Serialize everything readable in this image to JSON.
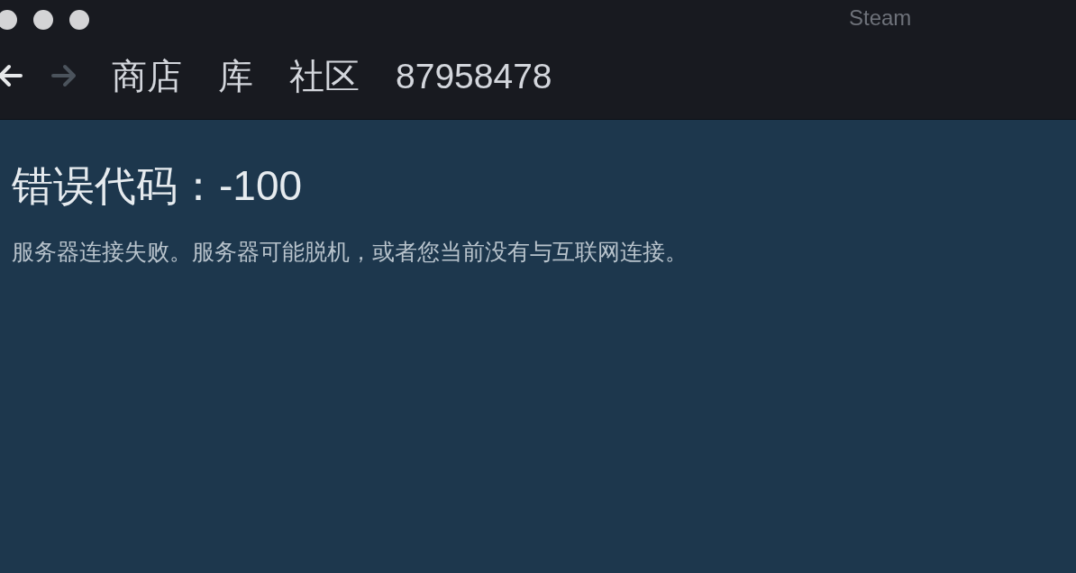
{
  "window": {
    "title": "Steam"
  },
  "navigation": {
    "back": {
      "disabled": false
    },
    "forward": {
      "disabled": true
    }
  },
  "tabs": [
    {
      "label": "商店"
    },
    {
      "label": "库"
    },
    {
      "label": "社区"
    },
    {
      "label": "87958478"
    }
  ],
  "error": {
    "heading": "错误代码：-100",
    "message": "服务器连接失败。服务器可能脱机，或者您当前没有与互联网连接。"
  }
}
